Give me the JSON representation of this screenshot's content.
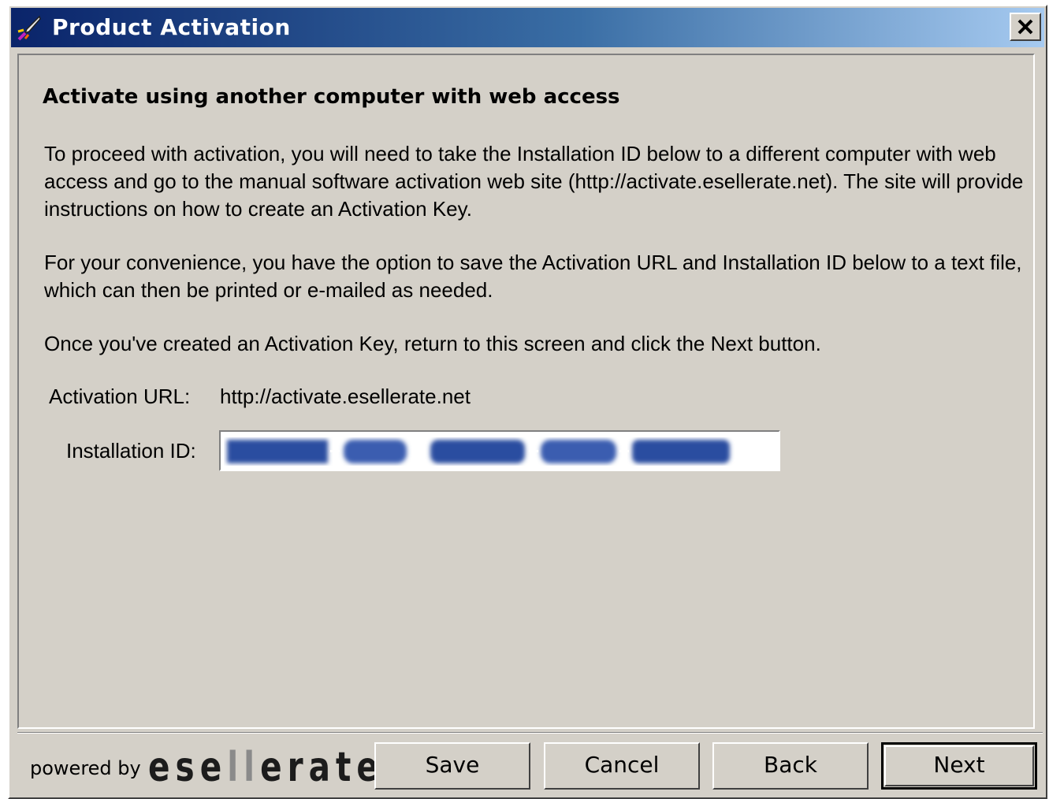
{
  "window": {
    "title": "Product Activation",
    "icon": "rocket-icon",
    "close_icon": "close-icon"
  },
  "main": {
    "heading": "Activate using another computer with web access",
    "paragraph1": "To proceed with activation, you will need to take the Installation ID below to a different computer with web access and go to the manual software activation web site (http://activate.esellerate.net). The site will provide instructions on how to create an Activation Key.",
    "paragraph2": "For your convenience, you have the option to save the Activation URL and Installation ID below to a text file, which can then be printed or e-mailed as needed.",
    "paragraph3": "Once you've created an Activation Key, return to this screen and click the Next button.",
    "url_label": "Activation URL:",
    "url_value": "http://activate.esellerate.net",
    "id_label": "Installation ID:"
  },
  "footer": {
    "powered_by": "powered by",
    "brand_part1": "ese",
    "brand_part2": "ll",
    "brand_part3": "erate",
    "buttons": {
      "save": "Save",
      "cancel": "Cancel",
      "back": "Back",
      "next": "Next"
    }
  },
  "colors": {
    "titlebar_start": "#0a246a",
    "titlebar_end": "#a6caf0",
    "dialog_bg": "#d4d0c8",
    "selection": "#0a246a"
  }
}
